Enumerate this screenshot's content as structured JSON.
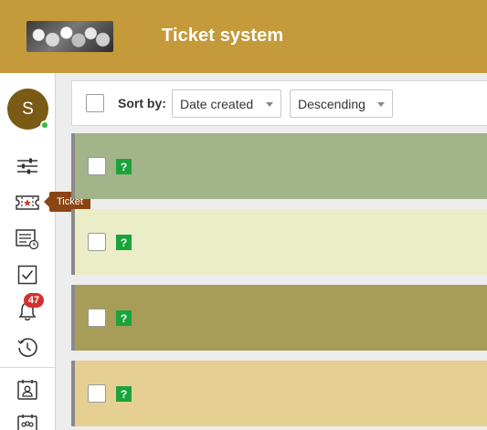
{
  "header": {
    "title": "Ticket system",
    "logo": "lottery-balls-logo",
    "background_color": "#c49a3a"
  },
  "sidebar": {
    "user_initial": "S",
    "avatar_color": "#7a5a14",
    "presence": "online",
    "tooltip": "Ticket",
    "notification_count": "47",
    "items": [
      {
        "name": "filters",
        "icon": "sliders-icon"
      },
      {
        "name": "ticket",
        "icon": "ticket-icon"
      },
      {
        "name": "reports",
        "icon": "document-clock-icon"
      },
      {
        "name": "tasks",
        "icon": "checkbox-icon"
      },
      {
        "name": "notifications",
        "icon": "bell-icon"
      },
      {
        "name": "history",
        "icon": "history-clock-icon"
      },
      {
        "name": "contact",
        "icon": "contact-card-icon"
      },
      {
        "name": "group",
        "icon": "group-card-icon"
      }
    ]
  },
  "toolbar": {
    "sort_label": "Sort by:",
    "sort_field": "Date created",
    "sort_order": "Descending"
  },
  "tickets": [
    {
      "status": "?",
      "color": "#a3b38a"
    },
    {
      "status": "?",
      "color": "#eaedc8"
    },
    {
      "status": "?",
      "color": "#a89d58"
    },
    {
      "status": "?",
      "color": "#e6cf92"
    }
  ]
}
